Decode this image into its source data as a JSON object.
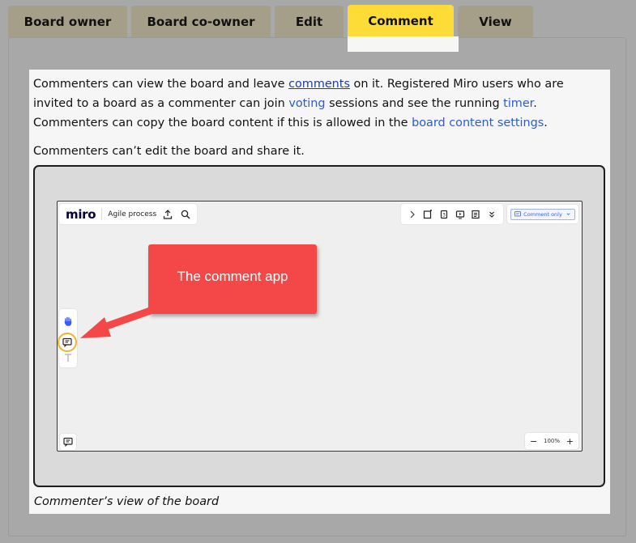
{
  "tabs": [
    {
      "label": "Board owner",
      "active": false
    },
    {
      "label": "Board co-owner",
      "active": false
    },
    {
      "label": "Edit",
      "active": false
    },
    {
      "label": "Comment",
      "active": true
    },
    {
      "label": "View",
      "active": false
    }
  ],
  "content": {
    "p1_a": "Commenters can view the board and leave ",
    "p1_link_comments": "comments",
    "p1_b": " on it. Registered Miro users who are invited to a board as a commenter can join ",
    "p1_link_voting": "voting",
    "p1_c": " sessions and see the running ",
    "p1_link_timer": "timer",
    "p1_d": ". Commenters can copy the board content if this is allowed in the ",
    "p1_link_settings": "board content settings",
    "p1_e": ".",
    "p2": "Commenters can’t edit the board and share it.",
    "caption": "Commenter’s view of the board"
  },
  "board": {
    "logo": "miro",
    "board_name": "Agile process",
    "access_mode": "Comment only",
    "zoom_level": "100%",
    "zoom_minus": "−",
    "zoom_plus": "+"
  },
  "callout": {
    "text": "The comment app"
  },
  "colors": {
    "tab_bg": "#a59f89",
    "tab_active": "#fddc38",
    "link": "#2a5bd7",
    "callout": "#f44848",
    "highlight_ring": "#f2b32a",
    "miro_blue": "#3859ff"
  }
}
